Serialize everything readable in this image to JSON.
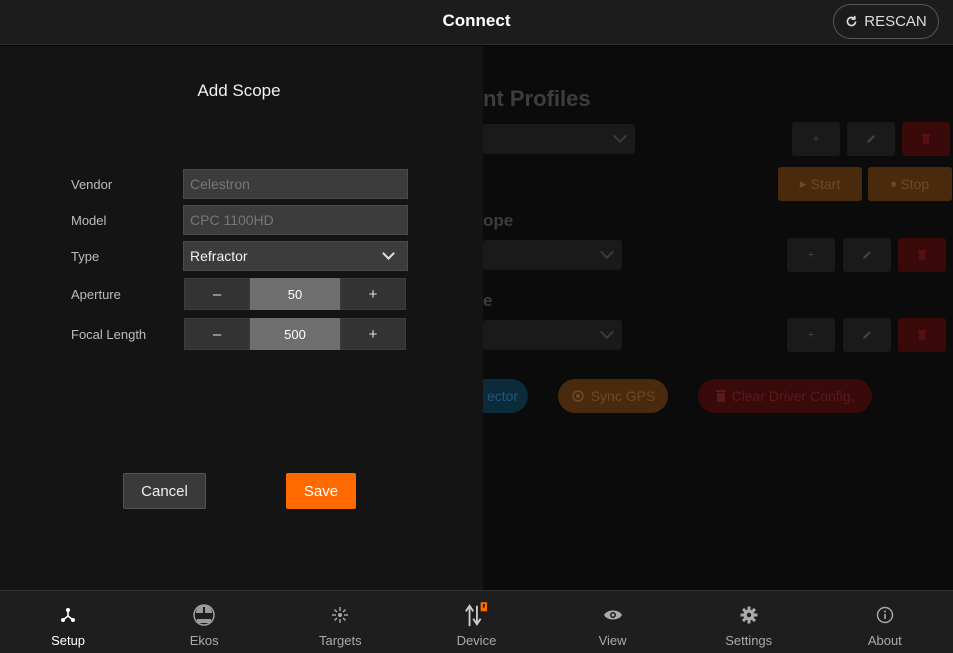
{
  "header": {
    "title": "Connect",
    "rescan_label": "RESCAN",
    "rescan_icon": "refresh-icon"
  },
  "background": {
    "heading": "nt Profiles",
    "scope_heading": "ope",
    "third_heading": "e",
    "start_label": "Start",
    "stop_label": "Stop",
    "selector_label": "ector",
    "sync_gps_label": "Sync GPS",
    "clear_driver_label": "Clear Driver Config.",
    "add_symbol": "+"
  },
  "modal": {
    "title": "Add Scope",
    "vendor": {
      "label": "Vendor",
      "placeholder": "Celestron"
    },
    "model": {
      "label": "Model",
      "placeholder": "CPC 1100HD"
    },
    "type": {
      "label": "Type",
      "value": "Refractor"
    },
    "aperture": {
      "label": "Aperture",
      "value": "50",
      "minus": "–",
      "plus": "+"
    },
    "focal_length": {
      "label": "Focal Length",
      "value": "500",
      "minus": "–",
      "plus": "+"
    },
    "cancel_label": "Cancel",
    "save_label": "Save"
  },
  "nav": {
    "items": [
      {
        "label": "Setup",
        "icon": "setup-icon",
        "active": true
      },
      {
        "label": "Ekos",
        "icon": "ekos-icon"
      },
      {
        "label": "Targets",
        "icon": "targets-icon"
      },
      {
        "label": "Device",
        "icon": "device-icon"
      },
      {
        "label": "View",
        "icon": "eye-icon"
      },
      {
        "label": "Settings",
        "icon": "gear-icon"
      },
      {
        "label": "About",
        "icon": "info-icon"
      }
    ]
  },
  "colors": {
    "accent": "#ff6a00",
    "background": "#000000",
    "modal": "#141414"
  }
}
